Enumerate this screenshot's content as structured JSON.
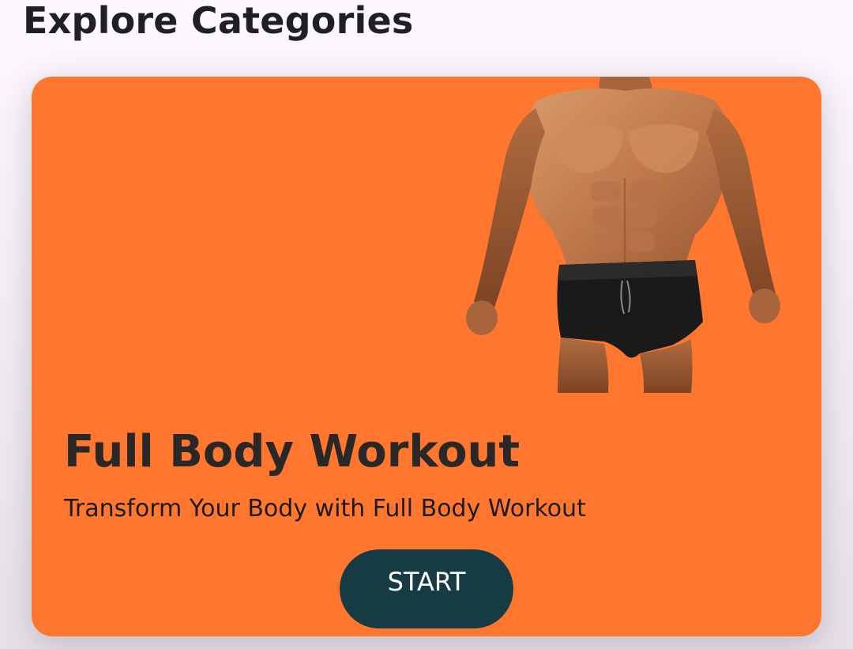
{
  "header": {
    "title": "Explore Categories"
  },
  "category_card": {
    "title": "Full Body Workout",
    "subtitle": "Transform Your Body with Full Body Workout",
    "button_label": "START",
    "image_icon": "muscular-man-photo",
    "colors": {
      "card_background": "#ff772f",
      "button_background": "#173b45",
      "button_text": "#ffffff",
      "title_text": "#2a2727"
    }
  }
}
